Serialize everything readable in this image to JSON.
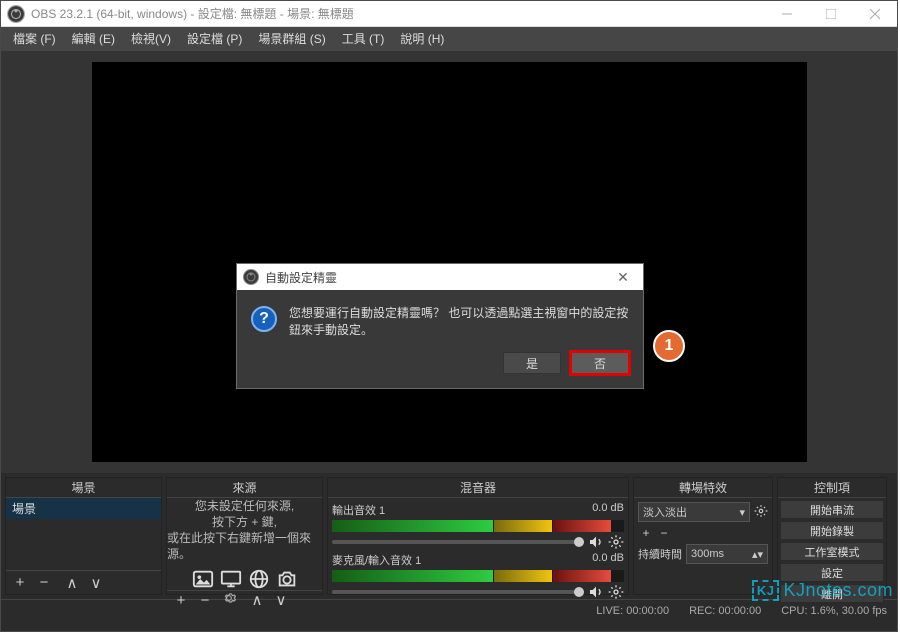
{
  "window": {
    "title": "OBS 23.2.1 (64-bit, windows) - 設定檔: 無標題 - 場景: 無標題"
  },
  "menu": {
    "items": [
      "檔案 (F)",
      "編輯 (E)",
      "檢視(V)",
      "設定檔 (P)",
      "場景群組 (S)",
      "工具 (T)",
      "說明 (H)"
    ]
  },
  "panels": {
    "scenes_header": "場景",
    "scene_item": "場景",
    "sources_header": "來源",
    "mixer_header": "混音器",
    "transitions_header": "轉場特效",
    "controls_header": "控制項"
  },
  "sources_help": {
    "l1": "您未設定任何來源,",
    "l2": "按下方 + 鍵,",
    "l3": "或在此按下右鍵新增一個來源。"
  },
  "mixer": {
    "ch": [
      {
        "name": "輸出音效 1",
        "db": "0.0 dB"
      },
      {
        "name": "麥克風/輸入音效 1",
        "db": "0.0 dB"
      }
    ]
  },
  "transitions": {
    "current": "淡入淡出",
    "duration_label": "持續時間",
    "duration_value": "300ms"
  },
  "controls": {
    "buttons": [
      "開始串流",
      "開始錄製",
      "工作室模式",
      "設定",
      "離開"
    ]
  },
  "status": {
    "live": "LIVE: 00:00:00",
    "rec": "REC: 00:00:00",
    "cpu": "CPU: 1.6%, 30.00 fps"
  },
  "dialog": {
    "title": "自動設定精靈",
    "msg": "您想要運行自動設定精靈嗎？ 也可以透過點選主視窗中的設定按鈕來手動設定。",
    "yes": "是",
    "no": "否"
  },
  "annotation": {
    "badge": "1"
  },
  "watermark": {
    "kj": "KJ",
    "text": "KJnotes.com"
  }
}
